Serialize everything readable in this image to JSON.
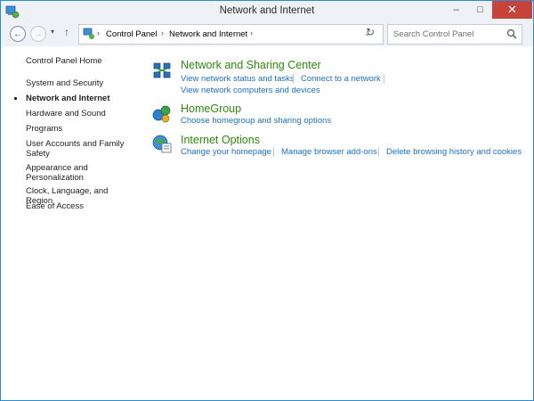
{
  "window": {
    "title": "Network and Internet",
    "minimize": "–",
    "maximize": "□",
    "close": "✕"
  },
  "nav": {
    "back_glyph": "←",
    "forward_glyph": "→",
    "recent_glyph": "▾",
    "up_glyph": "↑",
    "refresh_glyph": "↻"
  },
  "address": {
    "crumbs": [
      "Control Panel",
      "Network and Internet"
    ],
    "separator": "›",
    "dropdown_glyph": "⌄"
  },
  "search": {
    "placeholder": "Search Control Panel"
  },
  "sidebar": {
    "items": [
      {
        "label": "Control Panel Home"
      },
      {
        "label": "System and Security"
      },
      {
        "label": "Network and Internet",
        "active": true
      },
      {
        "label": "Hardware and Sound"
      },
      {
        "label": "Programs"
      },
      {
        "label": "User Accounts and Family Safety"
      },
      {
        "label": "Appearance and Personalization"
      },
      {
        "label": "Clock, Language, and Region"
      },
      {
        "label": "Ease of Access"
      }
    ]
  },
  "sections": [
    {
      "title": "Network and Sharing Center",
      "icon": "network-sharing-icon",
      "links": [
        "View network status and tasks",
        "Connect to a network",
        "View network computers and devices"
      ]
    },
    {
      "title": "HomeGroup",
      "icon": "homegroup-icon",
      "links": [
        "Choose homegroup and sharing options"
      ]
    },
    {
      "title": "Internet Options",
      "icon": "internet-options-icon",
      "links": [
        "Change your homepage",
        "Manage browser add-ons",
        "Delete browsing history and cookies"
      ]
    }
  ],
  "colors": {
    "link": "#1c6fc8",
    "section_title": "#2c8a0c",
    "close_button": "#c7443a",
    "window_border": "#2a8dd4"
  }
}
